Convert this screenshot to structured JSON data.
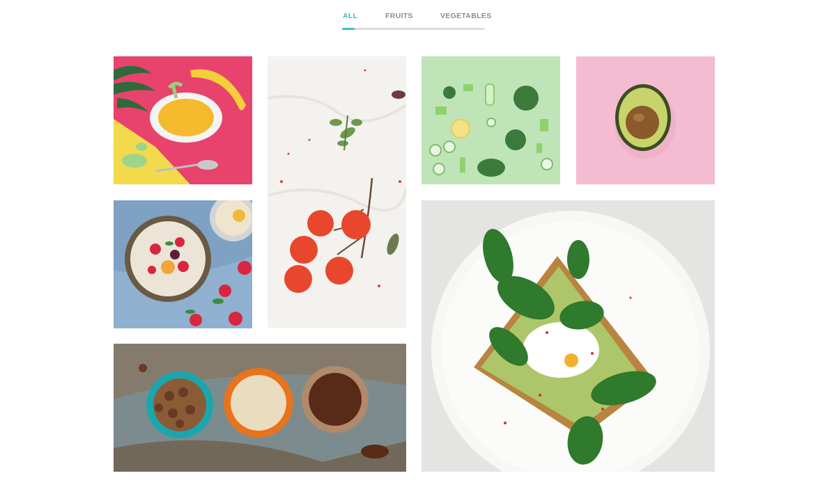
{
  "filters": {
    "tabs": [
      {
        "label": "ALL",
        "active": true
      },
      {
        "label": "FRUITS",
        "active": false
      },
      {
        "label": "VEGETABLES",
        "active": false
      }
    ],
    "accent_color": "#3cc0c6"
  },
  "gallery": {
    "items": [
      {
        "subject": "tropical fruit bowl with banana on pink and yellow background",
        "category": "fruits"
      },
      {
        "subject": "cherry tomatoes on the vine with herbs on white paper",
        "category": "vegetables"
      },
      {
        "subject": "cut green vegetables flat lay on mint background",
        "category": "vegetables"
      },
      {
        "subject": "half avocado on pink background",
        "category": "fruits"
      },
      {
        "subject": "oatmeal bowl with strawberries and berries",
        "category": "fruits"
      },
      {
        "subject": "avocado toast with spinach and poached egg on white plate",
        "category": "vegetables"
      },
      {
        "subject": "bowls of nuts and dates on rustic surface",
        "category": "fruits"
      }
    ]
  }
}
